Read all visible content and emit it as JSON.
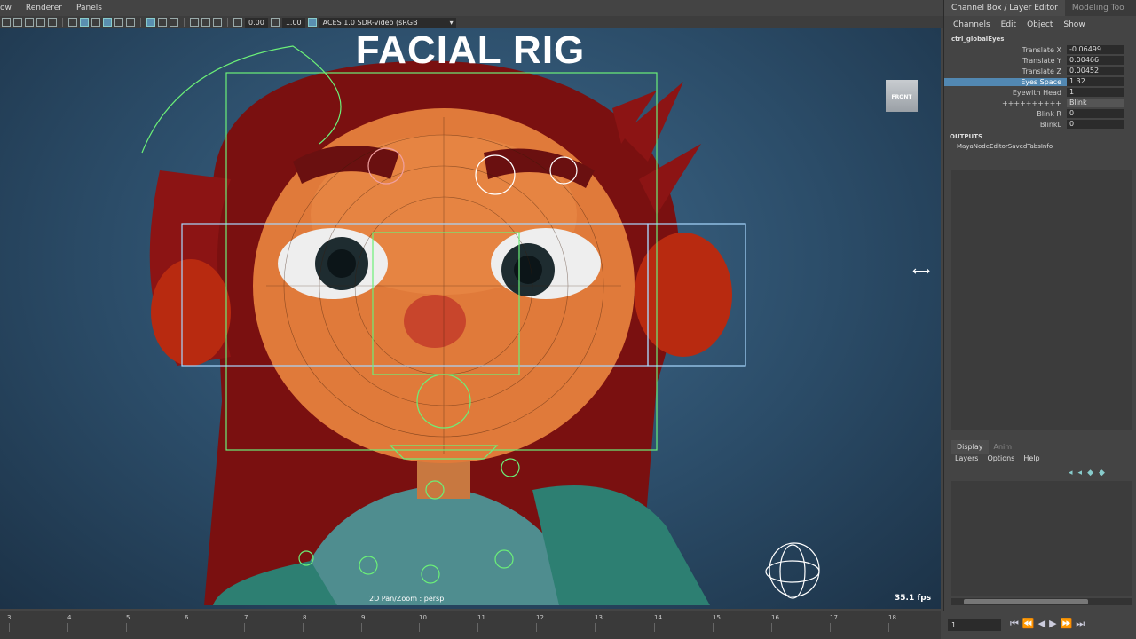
{
  "menubar": {
    "items": [
      "ow",
      "Renderer",
      "Panels"
    ]
  },
  "toolbar": {
    "exposure": "0.00",
    "gamma": "1.00",
    "color_space": "ACES 1.0 SDR-video (sRGB"
  },
  "viewport": {
    "title": "FACIAL RIG",
    "viewcube_label": "FRONT",
    "camera_label": "2D Pan/Zoom : persp",
    "fps": "35.1 fps"
  },
  "channel_box": {
    "tabs": [
      "Channel Box / Layer Editor",
      "Modeling Too"
    ],
    "menu": [
      "Channels",
      "Edit",
      "Object",
      "Show"
    ],
    "node_name": "ctrl_globalEyes",
    "attributes": [
      {
        "label": "Translate X",
        "value": "-0.06499"
      },
      {
        "label": "Translate Y",
        "value": "0.00466"
      },
      {
        "label": "Translate Z",
        "value": "0.00452"
      },
      {
        "label": "Eyes Space",
        "value": "1.32",
        "selected": true
      },
      {
        "label": "Eyewith Head",
        "value": "1"
      },
      {
        "label": "++++++++++",
        "value": "Blink"
      },
      {
        "label": "Blink R",
        "value": "0"
      },
      {
        "label": "BlinkL",
        "value": "0"
      }
    ],
    "outputs_heading": "OUTPUTS",
    "outputs": [
      "MayaNodeEditorSavedTabsInfo"
    ]
  },
  "layer_editor": {
    "tabs": [
      "Display",
      "Anim"
    ],
    "menu": [
      "Layers",
      "Options",
      "Help"
    ]
  },
  "timeline": {
    "ticks": [
      "3",
      "4",
      "5",
      "6",
      "7",
      "8",
      "9",
      "10",
      "11",
      "12",
      "13",
      "14",
      "15",
      "16",
      "17",
      "18"
    ],
    "current_frame": "1"
  }
}
